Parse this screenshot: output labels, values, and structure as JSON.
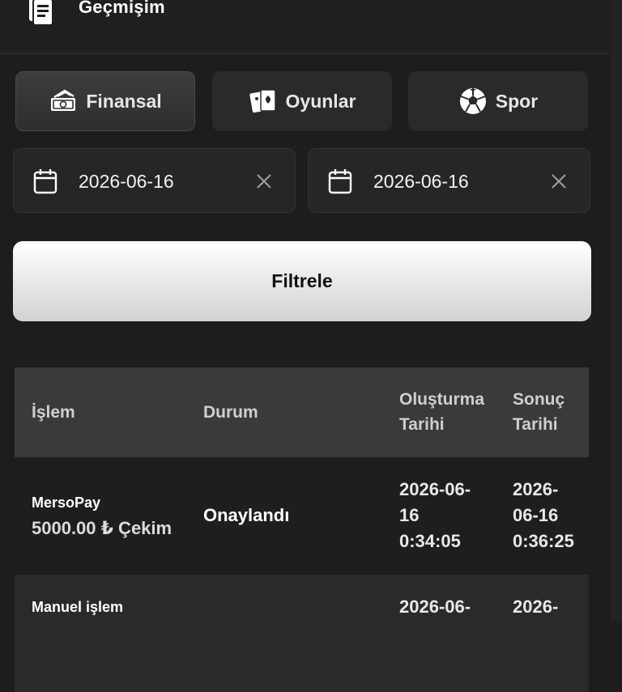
{
  "header": {
    "title": "Geçmişim",
    "icon": "document-list-icon"
  },
  "tabs": [
    {
      "label": "Finansal",
      "icon": "money-stack-icon",
      "active": true
    },
    {
      "label": "Oyunlar",
      "icon": "playing-cards-icon",
      "active": false
    },
    {
      "label": "Spor",
      "icon": "soccer-ball-icon",
      "active": false
    }
  ],
  "dates": {
    "start": {
      "value": "2026-06-16",
      "icon": "calendar-icon",
      "clear_icon": "close-icon"
    },
    "end": {
      "value": "2026-06-16",
      "icon": "calendar-icon",
      "clear_icon": "close-icon"
    }
  },
  "filter_label": "Filtrele",
  "table": {
    "headers": {
      "transaction": "İşlem",
      "status": "Durum",
      "created": "Oluşturma\nTarihi",
      "result": "Sonuç\nTarihi"
    },
    "rows": [
      {
        "name": "MersoPay",
        "amount": "5000.00 ₺ Çekim",
        "status": "Onaylandı",
        "created": "2026-06-\n16\n0:34:05",
        "result": "2026-\n06-16\n0:36:25"
      },
      {
        "name": "Manuel işlem",
        "amount": "",
        "status": "",
        "created": "2026-06-",
        "result": "2026-"
      }
    ]
  }
}
